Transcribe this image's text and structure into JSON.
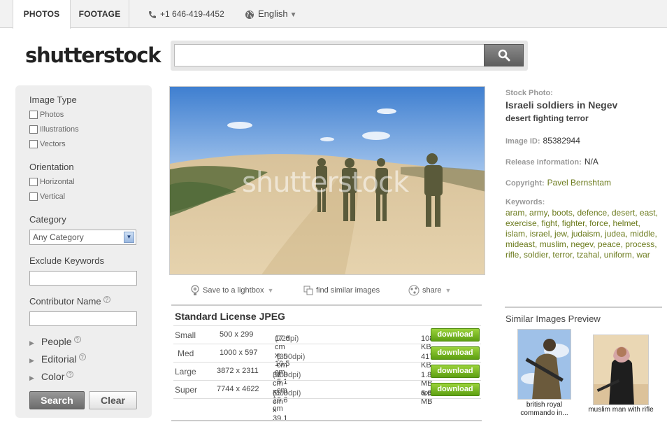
{
  "nav": {
    "tabs": [
      {
        "label": "PHOTOS"
      },
      {
        "label": "FOOTAGE"
      }
    ],
    "phone": "+1 646-419-4452",
    "language": "English"
  },
  "logo": "shutterstock",
  "search": {
    "value": "",
    "placeholder": ""
  },
  "sidebar": {
    "image_type_heading": "Image Type",
    "image_types": [
      "Photos",
      "Illustrations",
      "Vectors"
    ],
    "orientation_heading": "Orientation",
    "orientations": [
      "Horizontal",
      "Vertical"
    ],
    "category_heading": "Category",
    "category_value": "Any Category",
    "exclude_heading": "Exclude Keywords",
    "contributor_heading": "Contributor Name",
    "expanders": [
      "People",
      "Editorial",
      "Color"
    ],
    "search_button": "Search",
    "clear_button": "Clear"
  },
  "photo": {
    "watermark": "shutterstock"
  },
  "actions": {
    "lightbox": "Save to a lightbox",
    "similar": "find similar images",
    "share": "share"
  },
  "license": {
    "title": "Standard License JPEG",
    "download_label": "download",
    "rows": [
      {
        "size": "Small",
        "pixels": "500 x 299",
        "cm": "17.6 cm x 10.5 cm",
        "dpi": "(72dpi)",
        "file": "108 KB",
        "approx": ""
      },
      {
        "size": "Med",
        "pixels": "1000 x 597",
        "cm": "8.5 cm x 5.1 cm",
        "dpi": "(300dpi)",
        "file": "417 KB",
        "approx": ""
      },
      {
        "size": "Large",
        "pixels": "3872 x 2311",
        "cm": "32.8 cm x 19.6 cm",
        "dpi": "(300dpi)",
        "file": "1.8 MB",
        "approx": ""
      },
      {
        "size": "Super",
        "pixels": "7744 x 4622",
        "cm": "65.6 cm x 39.1 cm",
        "dpi": "(300dpi)",
        "file": "6.6 MB",
        "approx": "approx."
      }
    ]
  },
  "info": {
    "stock_label": "Stock Photo:",
    "title": "Israeli soldiers in Negev",
    "subtitle": "desert fighting terror",
    "image_id_label": "Image ID:",
    "image_id": "85382944",
    "release_label": "Release information:",
    "release": "N/A",
    "copyright_label": "Copyright:",
    "copyright": "Pavel Bernshtam",
    "keywords_label": "Keywords:",
    "keywords": [
      "aram",
      "army",
      "boots",
      "defence",
      "desert",
      "east",
      "exercise",
      "fight",
      "fighter",
      "force",
      "helmet",
      "islam",
      "israel",
      "jew",
      "judaism",
      "judea",
      "middle",
      "mideast",
      "muslim",
      "negev",
      "peace",
      "process",
      "rifle",
      "soldier",
      "terror",
      "tzahal",
      "uniform",
      "war"
    ]
  },
  "similar": {
    "title": "Similar Images Preview",
    "items": [
      {
        "caption_line1": "british royal",
        "caption_line2": "commando in..."
      },
      {
        "caption_line1": "muslim man with rifle",
        "caption_line2": ""
      }
    ]
  }
}
